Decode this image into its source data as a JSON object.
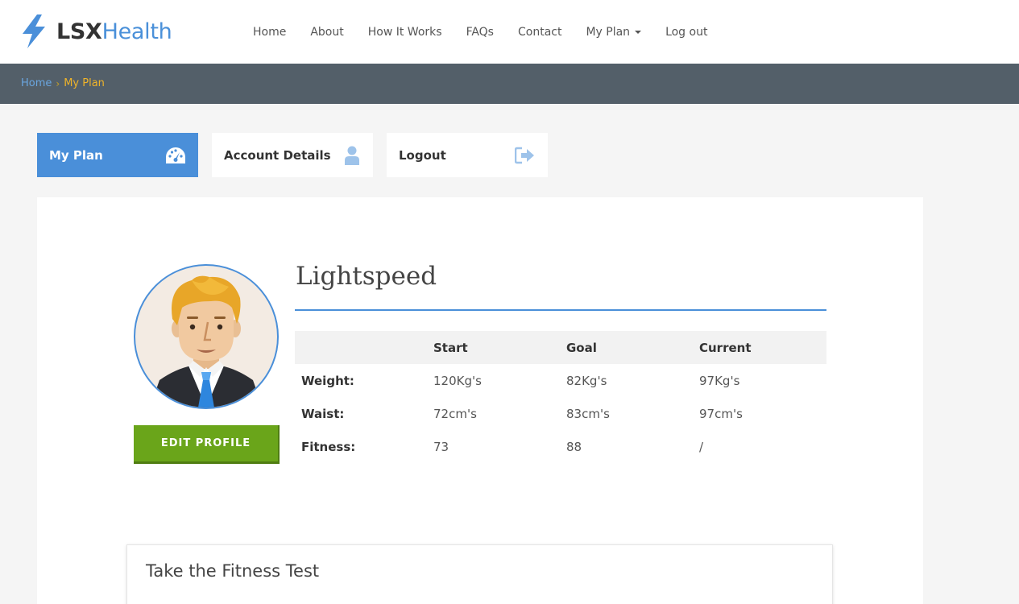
{
  "brand": {
    "name_part1": "LSX",
    "name_part2": "Health"
  },
  "nav": [
    {
      "label": "Home"
    },
    {
      "label": "About"
    },
    {
      "label": "How It Works"
    },
    {
      "label": "FAQs"
    },
    {
      "label": "Contact"
    },
    {
      "label": "My Plan",
      "has_dropdown": true
    },
    {
      "label": "Log out"
    }
  ],
  "breadcrumb": {
    "home": "Home",
    "separator": "›",
    "current": "My Plan"
  },
  "tabs": [
    {
      "label": "My Plan",
      "icon": "dashboard-icon",
      "active": true
    },
    {
      "label": "Account Details",
      "icon": "user-icon",
      "active": false
    },
    {
      "label": "Logout",
      "icon": "logout-icon",
      "active": false
    }
  ],
  "profile": {
    "name": "Lightspeed",
    "edit_button": "EDIT PROFILE",
    "avatar_icon": "avatar-man-icon"
  },
  "stats": {
    "headers": [
      "",
      "Start",
      "Goal",
      "Current"
    ],
    "rows": [
      {
        "label": "Weight:",
        "start": "120Kg's",
        "goal": "82Kg's",
        "current": "97Kg's"
      },
      {
        "label": "Waist:",
        "start": "72cm's",
        "goal": "83cm's",
        "current": "97cm's"
      },
      {
        "label": "Fitness:",
        "start": "73",
        "goal": "88",
        "current": "/"
      }
    ]
  },
  "fitness_test": {
    "title": "Take the Fitness Test"
  },
  "colors": {
    "accent": "#4a8fd9",
    "breadcrumb_bar": "#535f69",
    "breadcrumb_current": "#f0b429",
    "button_green": "#6aa51a"
  }
}
